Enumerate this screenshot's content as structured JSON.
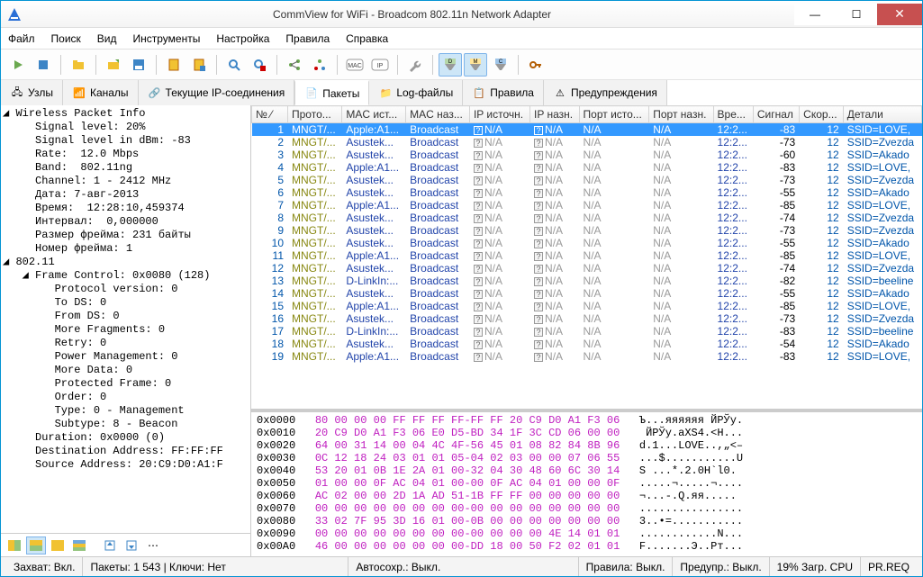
{
  "title": "CommView for WiFi - Broadcom 802.11n Network Adapter",
  "menu": [
    "Файл",
    "Поиск",
    "Вид",
    "Инструменты",
    "Настройка",
    "Правила",
    "Справка"
  ],
  "tabs": [
    {
      "label": "Узлы"
    },
    {
      "label": "Каналы"
    },
    {
      "label": "Текущие IP-соединения"
    },
    {
      "label": "Пакеты",
      "active": true
    },
    {
      "label": "Log-файлы"
    },
    {
      "label": "Правила"
    },
    {
      "label": "Предупреждения"
    }
  ],
  "tree": {
    "s1": "Wireless Packet Info",
    "l1": "Signal level: 20%",
    "l2": "Signal level in dBm: -83",
    "l3": "Rate:  12.0 Mbps",
    "l4": "Band:  802.11ng",
    "l5": "Channel: 1 - 2412 MHz",
    "l6": "Дата: 7-авг-2013",
    "l7": "Время:  12:28:10,459374",
    "l8": "Интервал:  0,000000",
    "l9": "Размер фрейма: 231 байты",
    "l10": "Номер фрейма: 1",
    "s2": "802.11",
    "l11": "Frame Control: 0x0080 (128)",
    "l12": "Protocol version: 0",
    "l13": "To DS: 0",
    "l14": "From DS: 0",
    "l15": "More Fragments: 0",
    "l16": "Retry: 0",
    "l17": "Power Management: 0",
    "l18": "More Data: 0",
    "l19": "Protected Frame: 0",
    "l20": "Order: 0",
    "l21": "Type: 0 - Management",
    "l22": "Subtype: 8 - Beacon",
    "l23": "Duration: 0x0000 (0)",
    "l24": "Destination Address: FF:FF:FF",
    "l25": "Source Address: 20:C9:D0:A1:F"
  },
  "columns": [
    "№  ⁄",
    "Прото...",
    "MAC ист...",
    "MAC наз...",
    "IP источн.",
    "IP назн.",
    "Порт исто...",
    "Порт назн.",
    "Вре...",
    "Сигнал",
    "Скор...",
    "Детали"
  ],
  "rows": [
    {
      "n": 1,
      "p": "MNGT/...",
      "ms": "Apple:A1...",
      "md": "Broadcast",
      "t": "12:2...",
      "sg": -83,
      "sp": 12,
      "d": "SSID=LOVE,",
      "sel": true
    },
    {
      "n": 2,
      "p": "MNGT/...",
      "ms": "Asustek...",
      "md": "Broadcast",
      "t": "12:2...",
      "sg": -73,
      "sp": 12,
      "d": "SSID=Zvezda"
    },
    {
      "n": 3,
      "p": "MNGT/...",
      "ms": "Asustek...",
      "md": "Broadcast",
      "t": "12:2...",
      "sg": -60,
      "sp": 12,
      "d": "SSID=Akado"
    },
    {
      "n": 4,
      "p": "MNGT/...",
      "ms": "Apple:A1...",
      "md": "Broadcast",
      "t": "12:2...",
      "sg": -83,
      "sp": 12,
      "d": "SSID=LOVE,"
    },
    {
      "n": 5,
      "p": "MNGT/...",
      "ms": "Asustek...",
      "md": "Broadcast",
      "t": "12:2...",
      "sg": -73,
      "sp": 12,
      "d": "SSID=Zvezda"
    },
    {
      "n": 6,
      "p": "MNGT/...",
      "ms": "Asustek...",
      "md": "Broadcast",
      "t": "12:2...",
      "sg": -55,
      "sp": 12,
      "d": "SSID=Akado"
    },
    {
      "n": 7,
      "p": "MNGT/...",
      "ms": "Apple:A1...",
      "md": "Broadcast",
      "t": "12:2...",
      "sg": -85,
      "sp": 12,
      "d": "SSID=LOVE,"
    },
    {
      "n": 8,
      "p": "MNGT/...",
      "ms": "Asustek...",
      "md": "Broadcast",
      "t": "12:2...",
      "sg": -74,
      "sp": 12,
      "d": "SSID=Zvezda"
    },
    {
      "n": 9,
      "p": "MNGT/...",
      "ms": "Asustek...",
      "md": "Broadcast",
      "t": "12:2...",
      "sg": -73,
      "sp": 12,
      "d": "SSID=Zvezda"
    },
    {
      "n": 10,
      "p": "MNGT/...",
      "ms": "Asustek...",
      "md": "Broadcast",
      "t": "12:2...",
      "sg": -55,
      "sp": 12,
      "d": "SSID=Akado"
    },
    {
      "n": 11,
      "p": "MNGT/...",
      "ms": "Apple:A1...",
      "md": "Broadcast",
      "t": "12:2...",
      "sg": -85,
      "sp": 12,
      "d": "SSID=LOVE,"
    },
    {
      "n": 12,
      "p": "MNGT/...",
      "ms": "Asustek...",
      "md": "Broadcast",
      "t": "12:2...",
      "sg": -74,
      "sp": 12,
      "d": "SSID=Zvezda"
    },
    {
      "n": 13,
      "p": "MNGT/...",
      "ms": "D-LinkIn:...",
      "md": "Broadcast",
      "t": "12:2...",
      "sg": -82,
      "sp": 12,
      "d": "SSID=beeline"
    },
    {
      "n": 14,
      "p": "MNGT/...",
      "ms": "Asustek...",
      "md": "Broadcast",
      "t": "12:2...",
      "sg": -55,
      "sp": 12,
      "d": "SSID=Akado"
    },
    {
      "n": 15,
      "p": "MNGT/...",
      "ms": "Apple:A1...",
      "md": "Broadcast",
      "t": "12:2...",
      "sg": -85,
      "sp": 12,
      "d": "SSID=LOVE,"
    },
    {
      "n": 16,
      "p": "MNGT/...",
      "ms": "Asustek...",
      "md": "Broadcast",
      "t": "12:2...",
      "sg": -73,
      "sp": 12,
      "d": "SSID=Zvezda"
    },
    {
      "n": 17,
      "p": "MNGT/...",
      "ms": "D-LinkIn:...",
      "md": "Broadcast",
      "t": "12:2...",
      "sg": -83,
      "sp": 12,
      "d": "SSID=beeline"
    },
    {
      "n": 18,
      "p": "MNGT/...",
      "ms": "Asustek...",
      "md": "Broadcast",
      "t": "12:2...",
      "sg": -54,
      "sp": 12,
      "d": "SSID=Akado"
    },
    {
      "n": 19,
      "p": "MNGT/...",
      "ms": "Apple:A1...",
      "md": "Broadcast",
      "t": "12:2...",
      "sg": -83,
      "sp": 12,
      "d": "SSID=LOVE,"
    }
  ],
  "hex": [
    {
      "a": "0x0000",
      "b": "80 00 00 00 FF FF FF FF-FF FF 20 C9 D0 A1 F3 06",
      "s": "Ъ...яяяяяя ЙРЎу."
    },
    {
      "a": "0x0010",
      "b": "20 C9 D0 A1 F3 06 E0 D5-BD 34 1F 3C CD 06 00 00",
      "s": " ЙРЎу.аХS4.<Н..."
    },
    {
      "a": "0x0020",
      "b": "64 00 31 14 00 04 4C 4F-56 45 01 08 82 84 8B 96",
      "s": "d.1...LOVE..,„<–"
    },
    {
      "a": "0x0030",
      "b": "0C 12 18 24 03 01 01 05-04 02 03 00 00 07 06 55",
      "s": "...$...........U"
    },
    {
      "a": "0x0040",
      "b": "53 20 01 0B 1E 2A 01 00-32 04 30 48 60 6C 30 14",
      "s": "S ...*.2.0H`l0."
    },
    {
      "a": "0x0050",
      "b": "01 00 00 0F AC 04 01 00-00 0F AC 04 01 00 00 0F",
      "s": ".....¬.....¬...."
    },
    {
      "a": "0x0060",
      "b": "AC 02 00 00 2D 1A AD 51-1B FF FF 00 00 00 00 00",
      "s": "¬...-.­Q.яя....."
    },
    {
      "a": "0x0070",
      "b": "00 00 00 00 00 00 00 00-00 00 00 00 00 00 00 00",
      "s": "................"
    },
    {
      "a": "0x0080",
      "b": "33 02 7F 95 3D 16 01 00-0B 00 00 00 00 00 00 00",
      "s": "3..•=..........."
    },
    {
      "a": "0x0090",
      "b": "00 00 00 00 00 00 00 00-00 00 00 00 4E 14 01 01",
      "s": "............N..."
    },
    {
      "a": "0x00A0",
      "b": "46 00 00 00 00 00 00 00-DD 18 00 50 F2 02 01 01",
      "s": "F.......Э..Pт..."
    }
  ],
  "status": {
    "s1": "Захват: Вкл.",
    "s2": "Пакеты: 1 543 | Ключи: Нет",
    "s3": "Автосохр.: Выкл.",
    "s4": "Правила: Выкл.",
    "s5": "Предупр.: Выкл.",
    "s6": "19% Загр. CPU",
    "s7": "PR.REQ"
  }
}
